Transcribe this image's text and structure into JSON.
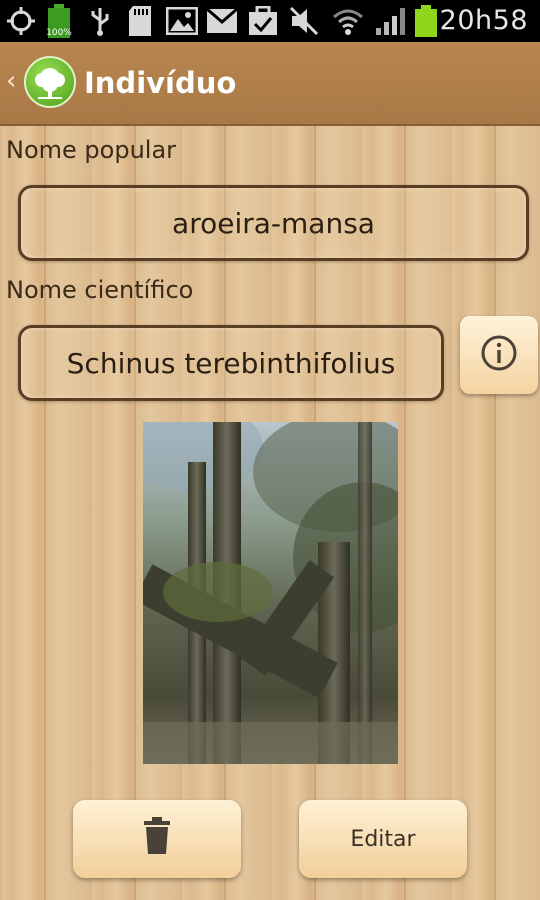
{
  "status_bar": {
    "time": "20h58",
    "battery_small_label": "100%",
    "icons": [
      "gps-icon",
      "battery-icon",
      "usb-icon",
      "sd-card-icon",
      "image-icon",
      "gmail-icon",
      "tasks-icon",
      "mute-icon",
      "wifi-icon",
      "signal-icon",
      "battery-icon"
    ]
  },
  "action_bar": {
    "title": "Indivíduo",
    "back_icon": "chevron-left-icon",
    "logo_icon": "tree-icon"
  },
  "form": {
    "popular_name_label": "Nome popular",
    "popular_name_value": "aroeira-mansa",
    "scientific_name_label": "Nome científico",
    "scientific_name_value": "Schinus terebinthifolius",
    "info_icon": "info-icon"
  },
  "photo": {
    "subject": "tree-photo"
  },
  "actions": {
    "delete_icon": "trash-icon",
    "edit_label": "Editar"
  }
}
